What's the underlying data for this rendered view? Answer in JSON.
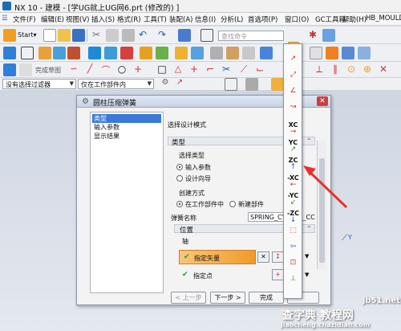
{
  "titlebar": {
    "title": "NX 10 - 建模 - [学UG就上UG网6.prt  (修改的) ]"
  },
  "menu": {
    "items": [
      "文件(F)",
      "编辑(E)",
      "视图(V)",
      "插入(S)",
      "格式(R)",
      "工具(T)",
      "装配(A)",
      "信息(I)",
      "分析(L)",
      "首选项(P)",
      "窗口(O)",
      "GC工具箱",
      "帮助(H)",
      "HB_MOULD"
    ]
  },
  "toolbar": {
    "start_label": "Start▾",
    "search_placeholder": "查找命令",
    "snap_label": "完成草图"
  },
  "filterbar": {
    "filter_value": "没有选择过滤器",
    "scope_value": "仅在工作部件内"
  },
  "dialog": {
    "title": "圆柱压缩弹簧",
    "nav": [
      "类型",
      "输入参数",
      "显示结果"
    ],
    "heading": "选择设计模式",
    "type_group": "类型",
    "select_type_label": "选择类型",
    "radio_input": "输入参数",
    "radio_wizard": "设计向导",
    "create_mode_label": "创建方式",
    "radio_in_work": "在工作部件中",
    "radio_new_part": "新建部件",
    "spring_name_label": "弹簧名称",
    "spring_name_value": "SPRING_CY",
    "spring_name_suffix": "R_CC",
    "position_label": "位置",
    "axis_label": "轴",
    "specify_vector": "指定矢量",
    "specify_point": "指定点",
    "btn_back": "< 上一步",
    "btn_next": "下一步 >",
    "btn_finish": "完成"
  },
  "vector_menu": {
    "items": [
      "XC",
      "YC",
      "ZC",
      "-XC",
      "-YC",
      "-ZC"
    ]
  },
  "watermark": {
    "site": "jb51.net",
    "tutorial": "查字典 教程网",
    "url": "jiaocheng.chazidian.com"
  }
}
